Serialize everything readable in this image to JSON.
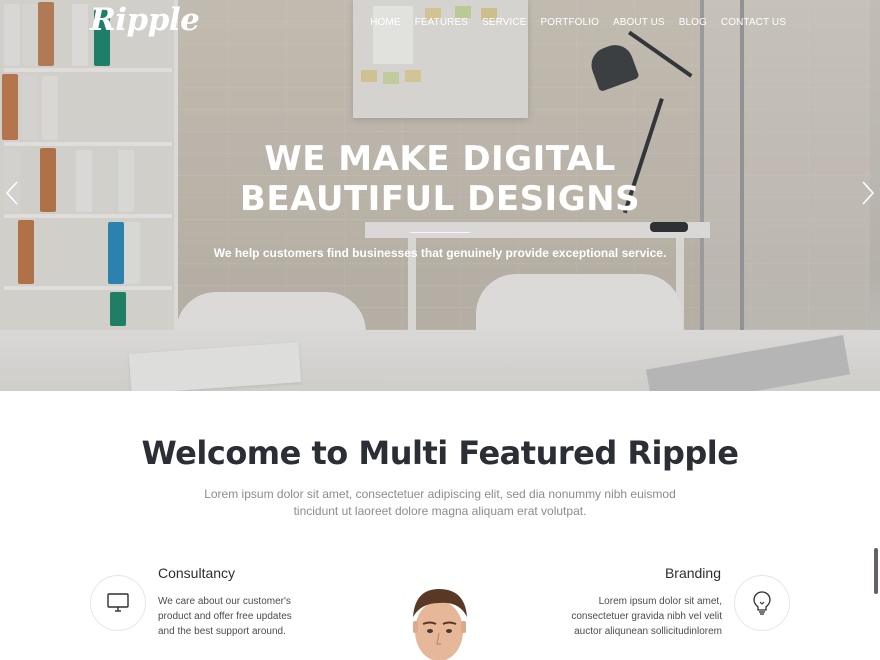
{
  "brand": {
    "logo": "Ripple"
  },
  "nav": {
    "items": [
      "HOME",
      "FEATURES",
      "SERVICE",
      "PORTFOLIO",
      "ABOUT US",
      "BLOG",
      "CONTACT US"
    ]
  },
  "hero": {
    "title_line1": "WE MAKE DIGITAL",
    "title_line2": "BEAUTIFUL DESIGNS",
    "subtitle": "We help customers find businesses that genuinely provide exceptional service."
  },
  "welcome": {
    "title": "Welcome to Multi Featured Ripple",
    "text_line1": "Lorem ipsum dolor sit amet, consectetuer adipiscing elit, sed dia nonummy nibh euismod",
    "text_line2": "tincidunt ut laoreet dolore magna aliquam erat volutpat."
  },
  "features": {
    "left": {
      "title": "Consultancy",
      "icon": "monitor-icon",
      "lines": [
        "We care about our customer's",
        "product and offer free updates",
        "and the best support around."
      ]
    },
    "right": {
      "title": "Branding",
      "icon": "lightbulb-icon",
      "lines": [
        "Lorem ipsum dolor sit amet,",
        "consectetuer gravida nibh vel velit",
        "auctor aliqunean sollicitudinlorem"
      ]
    }
  },
  "colors": {
    "heading": "#2b2e34",
    "muted": "#8a8c90",
    "white": "#ffffff"
  }
}
